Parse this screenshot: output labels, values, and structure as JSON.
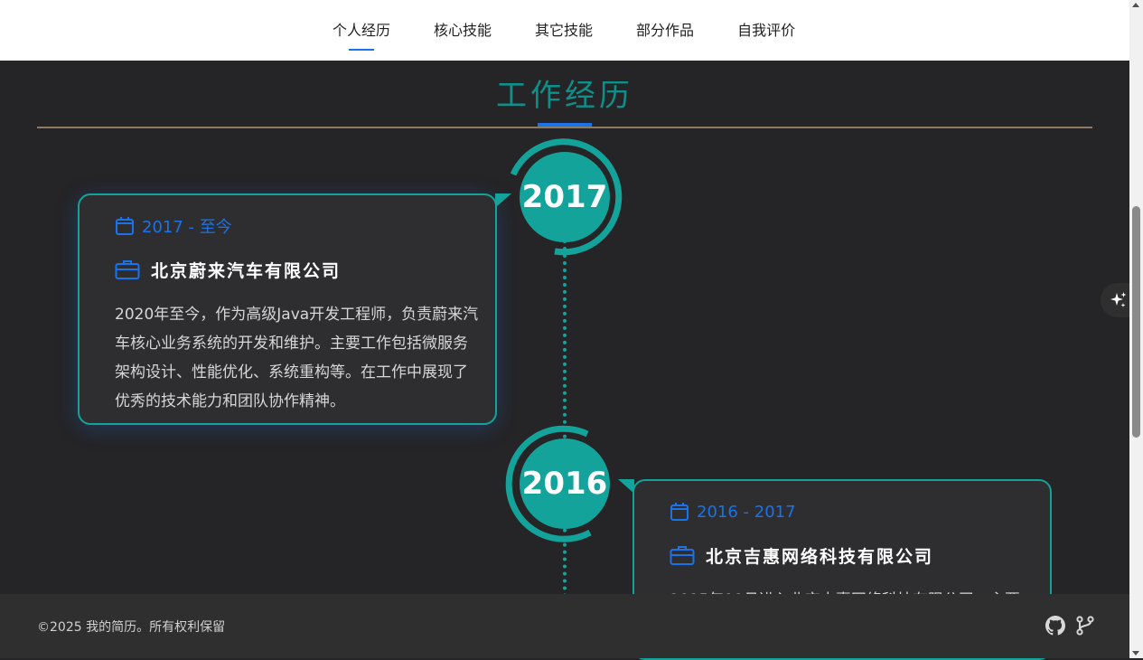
{
  "nav": {
    "items": [
      {
        "label": "个人经历"
      },
      {
        "label": "核心技能"
      },
      {
        "label": "其它技能"
      },
      {
        "label": "部分作品"
      },
      {
        "label": "自我评价"
      }
    ]
  },
  "section": {
    "title": "工作经历"
  },
  "timeline": [
    {
      "year": "2017",
      "date_range": "2017 - 至今",
      "company": "北京蔚来汽车有限公司",
      "description": "2020年至今，作为高级Java开发工程师，负责蔚来汽车核心业务系统的开发和维护。主要工作包括微服务架构设计、性能优化、系统重构等。在工作中展现了优秀的技术能力和团队协作精神。"
    },
    {
      "year": "2016",
      "date_range": "2016 - 2017",
      "company": "北京吉惠网络科技有限公司",
      "description": "2015年11月进入北京吉惠网络科技有限公司，主要"
    }
  ],
  "footer": {
    "copyright": "©2025 我的简历。所有权利保留"
  },
  "icons": {
    "calendar": "calendar-icon",
    "briefcase": "briefcase-icon",
    "github": "github-icon",
    "branch": "git-branch-icon",
    "sparkle": "sparkle-icon"
  },
  "colors": {
    "accent_teal": "#13a39a",
    "accent_blue": "#1a73e8",
    "background": "#252426",
    "card": "#2e2d2f"
  }
}
